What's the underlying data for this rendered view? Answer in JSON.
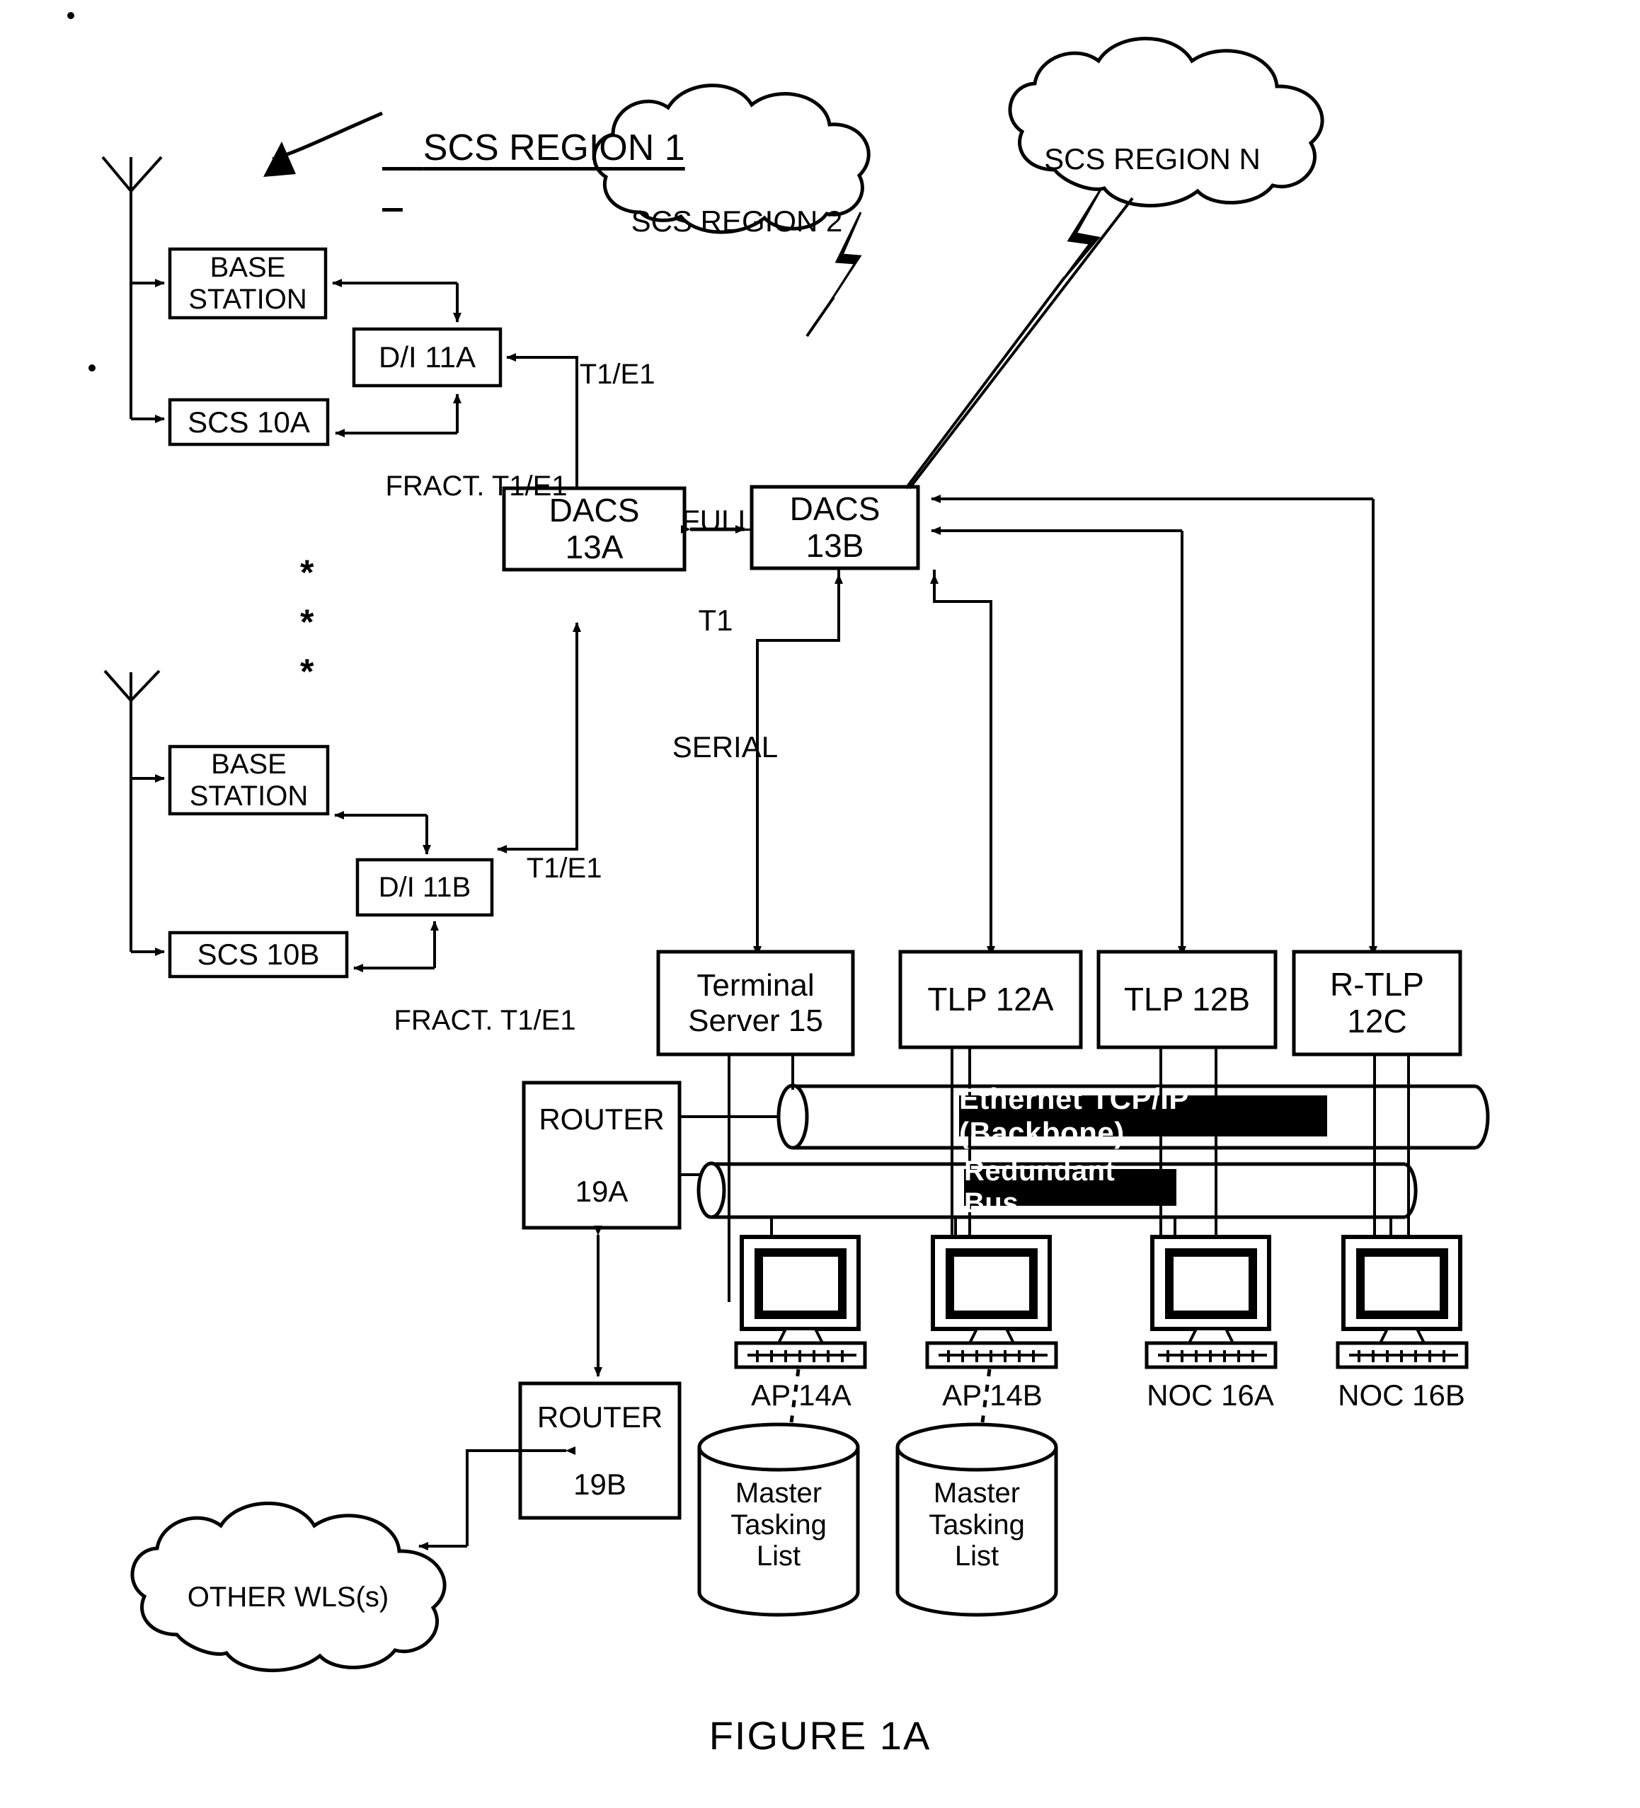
{
  "figure": {
    "caption": "FIGURE 1A"
  },
  "region_title": {
    "label": "SCS REGION 1"
  },
  "clouds": [
    {
      "name": "scs-region-2",
      "label": "SCS REGION 2"
    },
    {
      "name": "scs-region-n",
      "label": "SCS REGION N"
    },
    {
      "name": "other-wls",
      "label": "OTHER WLS(s)"
    }
  ],
  "boxes": {
    "base_station_1": {
      "line1": "BASE",
      "line2": "STATION"
    },
    "base_station_2": {
      "line1": "BASE",
      "line2": "STATION"
    },
    "di_11a": {
      "label": "D/I 11A"
    },
    "di_11b": {
      "label": "D/I 11B"
    },
    "scs_10a": {
      "label": "SCS 10A"
    },
    "scs_10b": {
      "label": "SCS 10B"
    },
    "dacs_13a": {
      "line1": "DACS",
      "line2": "13A"
    },
    "dacs_13b": {
      "line1": "DACS",
      "line2": "13B"
    },
    "terminal_server_15": {
      "line1": "Terminal",
      "line2": "Server 15"
    },
    "tlp_12a": {
      "label": "TLP 12A"
    },
    "tlp_12b": {
      "label": "TLP 12B"
    },
    "r_tlp_12c": {
      "line1": "R-TLP",
      "line2": "12C"
    },
    "router_19a": {
      "line1": "ROUTER",
      "line2": "19A"
    },
    "router_19b": {
      "line1": "ROUTER",
      "line2": "19B"
    }
  },
  "link_labels": {
    "t1e1_top": "T1/E1",
    "t1e1_bottom": "T1/E1",
    "fract_t1e1_top": "FRACT. T1/E1",
    "fract_t1e1_bottom": "FRACT. T1/E1",
    "full_t1_line1": "FULL",
    "full_t1_line2": "T1",
    "serial": "SERIAL"
  },
  "buses": [
    {
      "name": "ethernet-backbone",
      "label": "Ethernet TCP/IP (Backbone)"
    },
    {
      "name": "redundant-bus",
      "label": "Redundant Bus"
    }
  ],
  "workstations": [
    {
      "name": "ap-14a",
      "label": "AP 14A"
    },
    {
      "name": "ap-14b",
      "label": "AP 14B"
    },
    {
      "name": "noc-16a",
      "label": "NOC 16A"
    },
    {
      "name": "noc-16b",
      "label": "NOC 16B"
    }
  ],
  "databases": [
    {
      "name": "master-tasking-list-a",
      "line1": "Master",
      "line2": "Tasking",
      "line3": "List"
    },
    {
      "name": "master-tasking-list-b",
      "line1": "Master",
      "line2": "Tasking",
      "line3": "List"
    }
  ],
  "ellipsis": {
    "mark": "*"
  },
  "colors": {
    "ink": "#000000",
    "paper": "#ffffff",
    "bus_band_bg": "#000000",
    "bus_band_fg": "#ffffff"
  }
}
